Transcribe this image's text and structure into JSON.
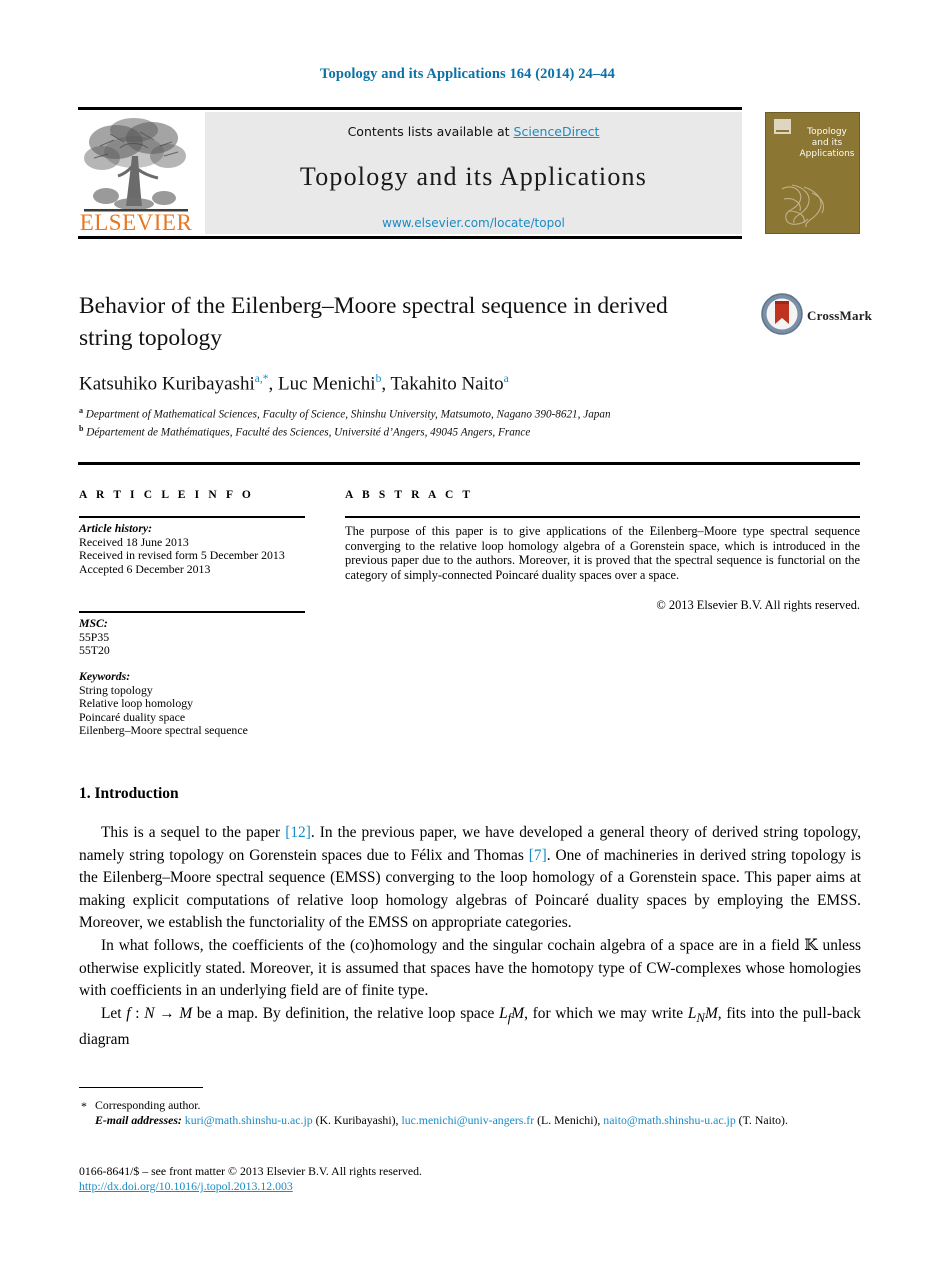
{
  "running_head": "Topology and its Applications 164 (2014) 24–44",
  "masthead": {
    "contents_prefix": "Contents lists available at ",
    "sciencedirect_link": "ScienceDirect",
    "journal_name": "Topology and its Applications",
    "journal_url": "www.elsevier.com/locate/topol",
    "publisher_logo_text": "ELSEVIER",
    "cover_title_line1": "Topology",
    "cover_title_line2": "and its",
    "cover_title_line3": "Applications"
  },
  "crossmark": {
    "label": "CrossMark"
  },
  "article": {
    "title": "Behavior of the Eilenberg–Moore spectral sequence in derived string topology",
    "authors_html": "Katsuhiko Kuribayashi<sup>a,*</sup>, Luc Menichi<sup>b</sup>, Takahito Naito<sup>a</sup>",
    "affiliation_a": "Department of Mathematical Sciences, Faculty of Science, Shinshu University, Matsumoto, Nagano 390-8621, Japan",
    "affiliation_b": "Département de Mathématiques, Faculté des Sciences, Université d’Angers, 49045 Angers, France"
  },
  "info": {
    "heading": "A R T I C L E   I N F O",
    "history_label": "Article history:",
    "history": [
      "Received 18 June 2013",
      "Received in revised form 5 December 2013",
      "Accepted 6 December 2013"
    ],
    "msc_label": "MSC:",
    "msc": [
      "55P35",
      "55T20"
    ],
    "keywords_label": "Keywords:",
    "keywords": [
      "String topology",
      "Relative loop homology",
      "Poincaré duality space",
      "Eilenberg–Moore spectral sequence"
    ]
  },
  "abstract": {
    "heading": "A B S T R A C T",
    "text": "The purpose of this paper is to give applications of the Eilenberg–Moore type spectral sequence converging to the relative loop homology algebra of a Gorenstein space, which is introduced in the previous paper due to the authors. Moreover, it is proved that the spectral sequence is functorial on the category of simply-connected Poincaré duality spaces over a space.",
    "copyright": "© 2013 Elsevier B.V. All rights reserved."
  },
  "body": {
    "section_number_title": "1. Introduction",
    "paragraph_1_html": "This is a sequel to the paper <span class=\"cite\">[12]</span>. In the previous paper, we have developed a general theory of derived string topology, namely string topology on Gorenstein spaces due to Félix and Thomas <span class=\"cite\">[7]</span>. One of machineries in derived string topology is the Eilenberg–Moore spectral sequence (EMSS) converging to the loop homology of a Gorenstein space. This paper aims at making explicit computations of relative loop homology algebras of Poincaré duality spaces by employing the EMSS. Moreover, we establish the functoriality of the EMSS on appropriate categories.",
    "paragraph_2_html": "In what follows, the coefficients of the (co)homology and the singular cochain algebra of a space are in a field 𝕂 unless otherwise explicitly stated. Moreover, it is assumed that spaces have the homotopy type of CW-complexes whose homologies with coefficients in an underlying field are of finite type.",
    "paragraph_3_html": "Let <span class=\"mi\">f</span> : <span class=\"mi\">N</span> → <span class=\"mi\">M</span> be a map. By definition, the relative loop space <span class=\"mi\">L<sub>f</sub>M</span>, for which we may write <span class=\"mi\">L<sub>N</sub>M</span>, fits into the pull-back diagram"
  },
  "footnotes": {
    "corresponding_star": "*",
    "corresponding_text": "Corresponding author.",
    "email_label": "E-mail addresses:",
    "emails_html": "<span class=\"flink\">kuri@math.shinshu-u.ac.jp</span> (K. Kuribayashi), <span class=\"flink\">luc.menichi@univ-angers.fr</span> (L. Menichi), <span class=\"flink\">naito@math.shinshu-u.ac.jp</span> (T. Naito).",
    "front_matter": "0166-8641/$ – see front matter  © 2013 Elsevier B.V. All rights reserved.",
    "doi": "http://dx.doi.org/10.1016/j.topol.2013.12.003"
  },
  "colors": {
    "link": "#1a8bc4",
    "running_head": "#0b72a8",
    "elsevier_orange": "#e87722",
    "cover_olive": "#8c7634",
    "crossmark_red": "#bf3322",
    "crossmark_blue": "#7a8fa6"
  }
}
